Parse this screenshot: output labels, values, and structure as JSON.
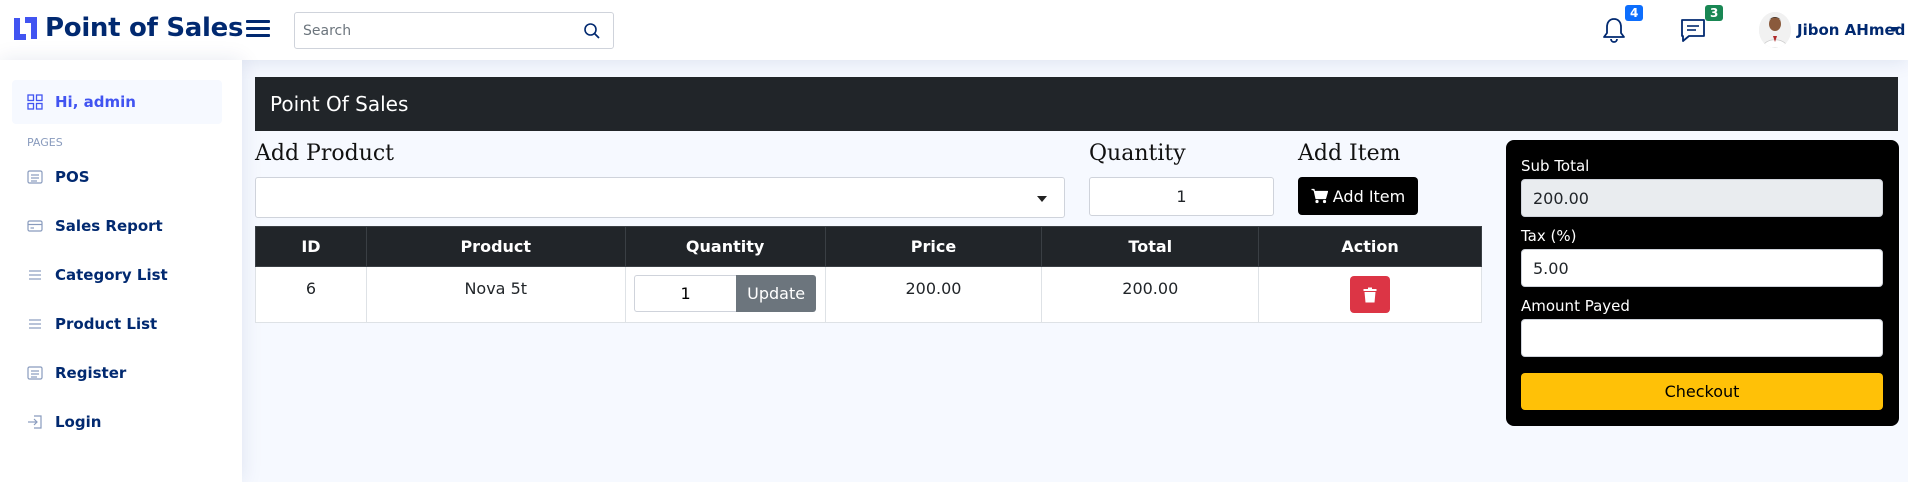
{
  "header": {
    "logo_text": "Point of Sales",
    "search_placeholder": "Search",
    "notifications_count": "4",
    "messages_count": "3",
    "user_name": "Jibon AHmed"
  },
  "sidebar": {
    "greeting": "Hi, admin",
    "section_heading": "PAGES",
    "items": [
      {
        "label": "POS",
        "icon": "list-icon"
      },
      {
        "label": "Sales Report",
        "icon": "card-icon"
      },
      {
        "label": "Category List",
        "icon": "list-icon"
      },
      {
        "label": "Product List",
        "icon": "list-icon"
      },
      {
        "label": "Register",
        "icon": "card-list-icon"
      },
      {
        "label": "Login",
        "icon": "login-icon"
      }
    ]
  },
  "main": {
    "title": "Point Of Sales",
    "add_product_label": "Add Product",
    "quantity_label": "Quantity",
    "quantity_value": "1",
    "add_item_label": "Add Item",
    "add_item_button": "Add Item",
    "table": {
      "columns": [
        "ID",
        "Product",
        "Quantity",
        "Price",
        "Total",
        "Action"
      ],
      "rows": [
        {
          "id": "6",
          "product": "Nova 5t",
          "quantity": "1",
          "price": "200.00",
          "total": "200.00",
          "update_label": "Update"
        }
      ]
    }
  },
  "summary": {
    "subtotal_label": "Sub Total",
    "subtotal_value": "200.00",
    "tax_label": "Tax (%)",
    "tax_value": "5.00",
    "amount_label": "Amount Payed",
    "amount_value": "",
    "checkout_label": "Checkout"
  },
  "colors": {
    "brand": "#012970",
    "accent": "#4154f1",
    "dark": "#212529",
    "checkout": "#ffc107",
    "delete": "#dc3545"
  }
}
